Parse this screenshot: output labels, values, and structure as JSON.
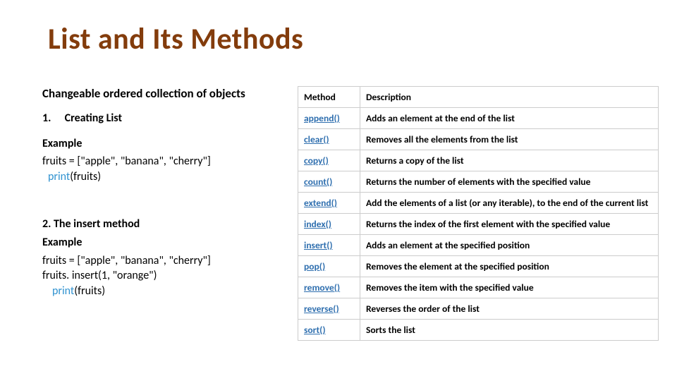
{
  "title": "List and Its Methods",
  "left": {
    "subtitle": "Changeable ordered collection of objects",
    "section1_num": "1.",
    "section1_title": "Creating List",
    "example_label": "Example",
    "code1_line1": "fruits = [\"apple\", \"banana\", \"cherry\"]",
    "print_kw": "print",
    "print_arg": "(fruits)",
    "section2_title": "2. The insert method",
    "code2_line1": "fruits = [\"apple\", \"banana\", \"cherry\"]",
    "code2_line2": "fruits. insert(1, \"orange\")"
  },
  "table": {
    "header_method": "Method",
    "header_desc": "Description",
    "rows": [
      {
        "method": "append()",
        "desc": "Adds an element at the end of the list"
      },
      {
        "method": "clear()",
        "desc": "Removes all the elements from the list"
      },
      {
        "method": "copy()",
        "desc": "Returns a copy of the list"
      },
      {
        "method": "count()",
        "desc": "Returns the number of elements with the specified value"
      },
      {
        "method": "extend()",
        "desc": "Add the elements of a list (or any iterable), to the end of the current list"
      },
      {
        "method": "index()",
        "desc": "Returns the index of the first element with the specified value"
      },
      {
        "method": "insert()",
        "desc": "Adds an element at the specified position"
      },
      {
        "method": "pop()",
        "desc": "Removes the element at the specified position"
      },
      {
        "method": "remove()",
        "desc": "Removes the item with the specified value"
      },
      {
        "method": "reverse()",
        "desc": "Reverses the order of the list"
      },
      {
        "method": "sort()",
        "desc": "Sorts the list"
      }
    ]
  }
}
